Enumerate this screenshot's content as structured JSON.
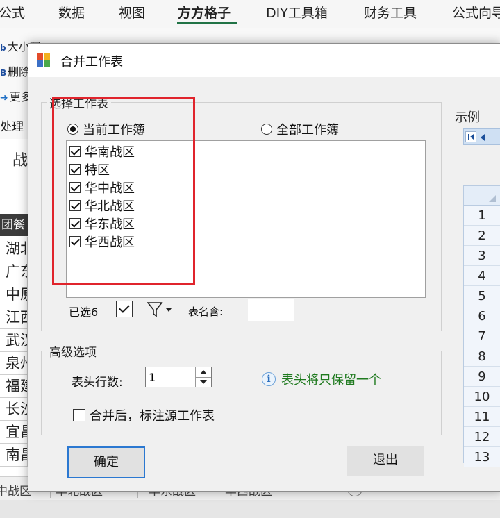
{
  "ribbon": {
    "tabs": [
      "公式",
      "数据",
      "视图",
      "方方格子",
      "DIY工具箱",
      "财务工具",
      "公式向导"
    ],
    "active_tab": "方方格子",
    "items": [
      "大小写",
      "删除",
      "更多"
    ],
    "group_label": "处理",
    "accent_color": "#217346"
  },
  "sheet": {
    "name_box": "战",
    "header_cell": "团餐",
    "cells": [
      "湖北",
      "广东",
      "中原",
      "江西",
      "武汉",
      "泉州",
      "福建",
      "长沙",
      "宜昌",
      "南昌"
    ],
    "tabs": [
      "中战区",
      "华北战区",
      "华东战区",
      "华西战区"
    ]
  },
  "dialog": {
    "title": "合并工作表",
    "section_select": "选择工作表",
    "radio_current": "当前工作簿",
    "radio_all": "全部工作簿",
    "selected_radio": "current",
    "sheets": [
      {
        "label": "华南战区",
        "checked": true
      },
      {
        "label": "特区",
        "checked": true
      },
      {
        "label": "华中战区",
        "checked": true
      },
      {
        "label": "华北战区",
        "checked": true
      },
      {
        "label": "华东战区",
        "checked": true
      },
      {
        "label": "华西战区",
        "checked": true
      }
    ],
    "selected_count": "已选6",
    "name_filter_label": "表名含:",
    "name_filter_value": "",
    "section_advanced": "高级选项",
    "header_rows_label": "表头行数:",
    "header_rows_value": "1",
    "hint_text": "表头将只保留一个",
    "hint_color": "#1f7a1f",
    "mark_source_label": "合并后，标注源工作表",
    "mark_source_checked": false,
    "ok_button": "确定",
    "exit_button": "退出",
    "highlight_color": "#e0242c"
  },
  "preview": {
    "title": "示例",
    "row_numbers": [
      "1",
      "2",
      "3",
      "4",
      "5",
      "6",
      "7",
      "8",
      "9",
      "10",
      "11",
      "12",
      "13"
    ]
  }
}
